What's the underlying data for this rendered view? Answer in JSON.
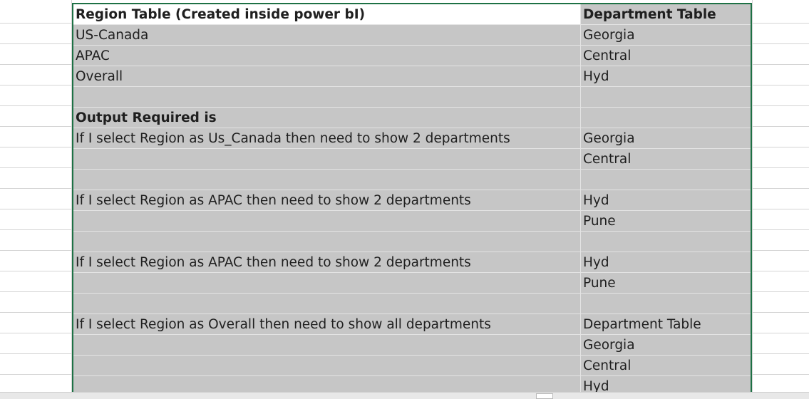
{
  "rows": [
    {
      "a": "Region Table (Created inside power bI)",
      "b": "Department Table",
      "bold": true,
      "white_a": true
    },
    {
      "a": "US-Canada",
      "b": "Georgia"
    },
    {
      "a": "APAC",
      "b": "Central"
    },
    {
      "a": "Overall",
      "b": "Hyd"
    },
    {
      "a": "",
      "b": ""
    },
    {
      "a": "Output Required is",
      "b": "",
      "bold_a": true
    },
    {
      "a": "If I select Region as Us_Canada then need to show 2 departments",
      "b": "Georgia"
    },
    {
      "a": "",
      "b": "Central"
    },
    {
      "a": "",
      "b": ""
    },
    {
      "a": "If I select Region as APAC then need to show 2 departments",
      "b": "Hyd"
    },
    {
      "a": "",
      "b": "Pune"
    },
    {
      "a": "",
      "b": ""
    },
    {
      "a": "If I select Region as APAC then need to show 2 departments",
      "b": "Hyd"
    },
    {
      "a": "",
      "b": "Pune"
    },
    {
      "a": "",
      "b": ""
    },
    {
      "a": "If I select Region as Overall then need to show all departments",
      "b": "Department Table"
    },
    {
      "a": "",
      "b": "Georgia"
    },
    {
      "a": "",
      "b": "Central"
    },
    {
      "a": "",
      "b": "Hyd"
    }
  ],
  "colors": {
    "cell_fill": "#c6c6c6",
    "selection_border": "#1e7145"
  }
}
